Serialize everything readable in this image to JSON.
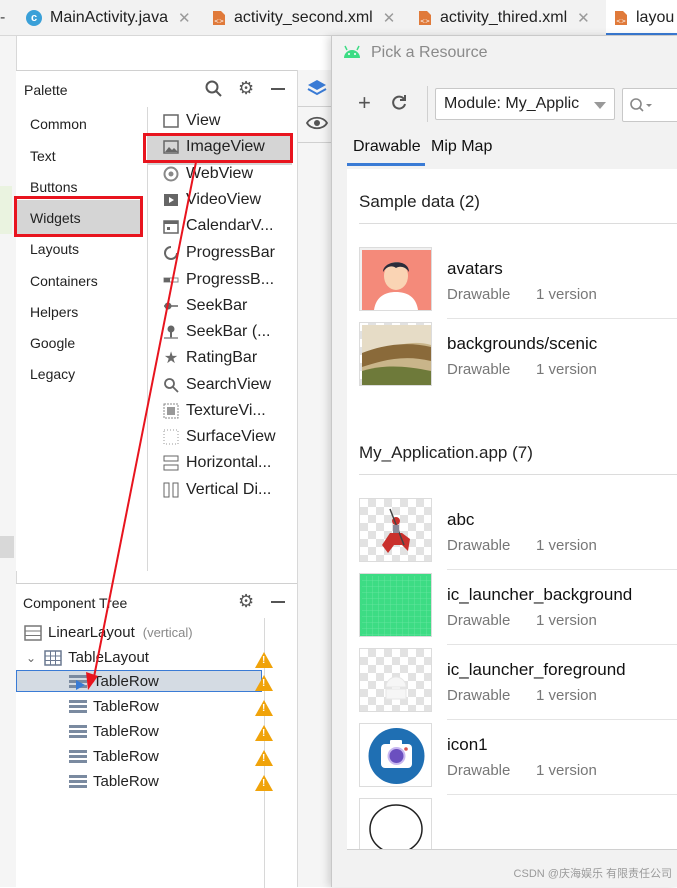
{
  "tabs": [
    {
      "label": "MainActivity.java",
      "icon": "java-class-icon"
    },
    {
      "label": "activity_second.xml",
      "icon": "xml-file-icon"
    },
    {
      "label": "activity_thired.xml",
      "icon": "xml-file-icon"
    },
    {
      "label": "layou",
      "icon": "xml-file-icon"
    }
  ],
  "palette": {
    "title": "Palette",
    "categories": [
      "Common",
      "Text",
      "Buttons",
      "Widgets",
      "Layouts",
      "Containers",
      "Helpers",
      "Google",
      "Legacy"
    ],
    "selected_category": "Widgets",
    "widgets": [
      "View",
      "ImageView",
      "WebView",
      "VideoView",
      "CalendarV...",
      "ProgressBar",
      "ProgressB...",
      "SeekBar",
      "SeekBar (...",
      "RatingBar",
      "SearchView",
      "TextureVi...",
      "SurfaceView",
      "Horizontal...",
      "Vertical Di..."
    ],
    "highlighted_widget": "ImageView"
  },
  "component_tree": {
    "title": "Component Tree",
    "root": {
      "label": "LinearLayout",
      "hint": "(vertical)"
    },
    "table_layout": "TableLayout",
    "rows": [
      "TableRow",
      "TableRow",
      "TableRow",
      "TableRow",
      "TableRow"
    ]
  },
  "dialog": {
    "title": "Pick a Resource",
    "module_select": "Module: My_Applic",
    "tabs": [
      "Drawable",
      "Mip Map"
    ],
    "active_tab": "Drawable",
    "sections": [
      {
        "header": "Sample data (2)",
        "items": [
          {
            "name": "avatars",
            "type": "Drawable",
            "versions": "1 version"
          },
          {
            "name": "backgrounds/scenic",
            "type": "Drawable",
            "versions": "1 version"
          }
        ]
      },
      {
        "header": "My_Application.app (7)",
        "items": [
          {
            "name": "abc",
            "type": "Drawable",
            "versions": "1 version"
          },
          {
            "name": "ic_launcher_background",
            "type": "Drawable",
            "versions": "1 version"
          },
          {
            "name": "ic_launcher_foreground",
            "type": "Drawable",
            "versions": "1 version"
          },
          {
            "name": "icon1",
            "type": "Drawable",
            "versions": "1 version"
          }
        ]
      }
    ]
  },
  "watermark": "CSDN @庆海娱乐 有限责任公司",
  "colors": {
    "annotation_red": "#e8141e",
    "selection_blue": "#3a7bd5",
    "warning": "#f0a30a",
    "android_green": "#3ddc84"
  }
}
